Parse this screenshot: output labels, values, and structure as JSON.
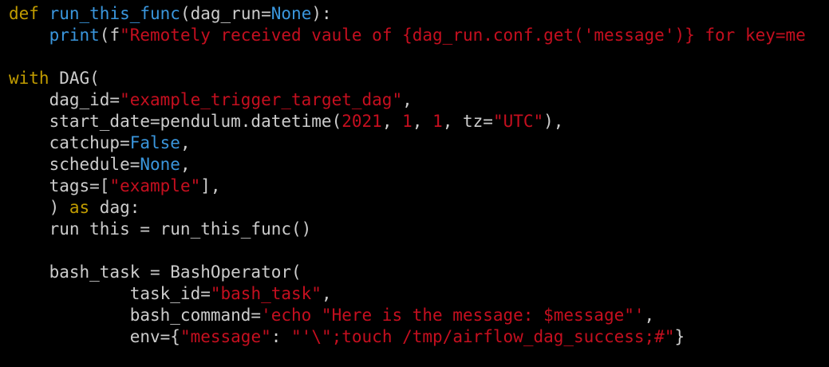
{
  "theme": {
    "background": "#000000",
    "default": "#cccccc",
    "keyword": "#c19c00",
    "function": "#3a96dd",
    "builtin": "#3a96dd",
    "constant": "#3a96dd",
    "string": "#c50f1f",
    "number": "#c50f1f"
  },
  "code_lines": [
    [
      {
        "t": "def",
        "k": "keyword"
      },
      {
        "t": " "
      },
      {
        "t": "run_this_func",
        "k": "function"
      },
      {
        "t": "(dag_run="
      },
      {
        "t": "None",
        "k": "constant"
      },
      {
        "t": "):"
      }
    ],
    [
      {
        "t": "    "
      },
      {
        "t": "print",
        "k": "builtin"
      },
      {
        "t": "(f"
      },
      {
        "t": "\"Remotely received vaule of {dag_run.conf.get('message')} for key=me",
        "k": "string"
      }
    ],
    [],
    [
      {
        "t": "with",
        "k": "keyword"
      },
      {
        "t": " DAG("
      }
    ],
    [
      {
        "t": "    dag_id="
      },
      {
        "t": "\"example_trigger_target_dag\"",
        "k": "string"
      },
      {
        "t": ","
      }
    ],
    [
      {
        "t": "    start_date=pendulum.datetime("
      },
      {
        "t": "2021",
        "k": "number"
      },
      {
        "t": ", "
      },
      {
        "t": "1",
        "k": "number"
      },
      {
        "t": ", "
      },
      {
        "t": "1",
        "k": "number"
      },
      {
        "t": ", tz="
      },
      {
        "t": "\"UTC\"",
        "k": "string"
      },
      {
        "t": "),"
      }
    ],
    [
      {
        "t": "    catchup="
      },
      {
        "t": "False",
        "k": "constant"
      },
      {
        "t": ","
      }
    ],
    [
      {
        "t": "    schedule="
      },
      {
        "t": "None",
        "k": "constant"
      },
      {
        "t": ","
      }
    ],
    [
      {
        "t": "    tags=["
      },
      {
        "t": "\"example\"",
        "k": "string"
      },
      {
        "t": "],"
      }
    ],
    [
      {
        "t": "    ) "
      },
      {
        "t": "as",
        "k": "keyword"
      },
      {
        "t": " dag:"
      }
    ],
    [
      {
        "t": "    run this = run_this_func()"
      }
    ],
    [],
    [
      {
        "t": "    bash_task = BashOperator("
      }
    ],
    [
      {
        "t": "            task_id="
      },
      {
        "t": "\"bash_task\"",
        "k": "string"
      },
      {
        "t": ","
      }
    ],
    [
      {
        "t": "            bash_command="
      },
      {
        "t": "'echo \"Here is the message: $message\"'",
        "k": "string"
      },
      {
        "t": ","
      }
    ],
    [
      {
        "t": "            env={"
      },
      {
        "t": "\"message\"",
        "k": "string"
      },
      {
        "t": ": "
      },
      {
        "t": "\"'\\\";touch /tmp/airflow_dag_success;#\"",
        "k": "string"
      },
      {
        "t": "}"
      }
    ]
  ]
}
